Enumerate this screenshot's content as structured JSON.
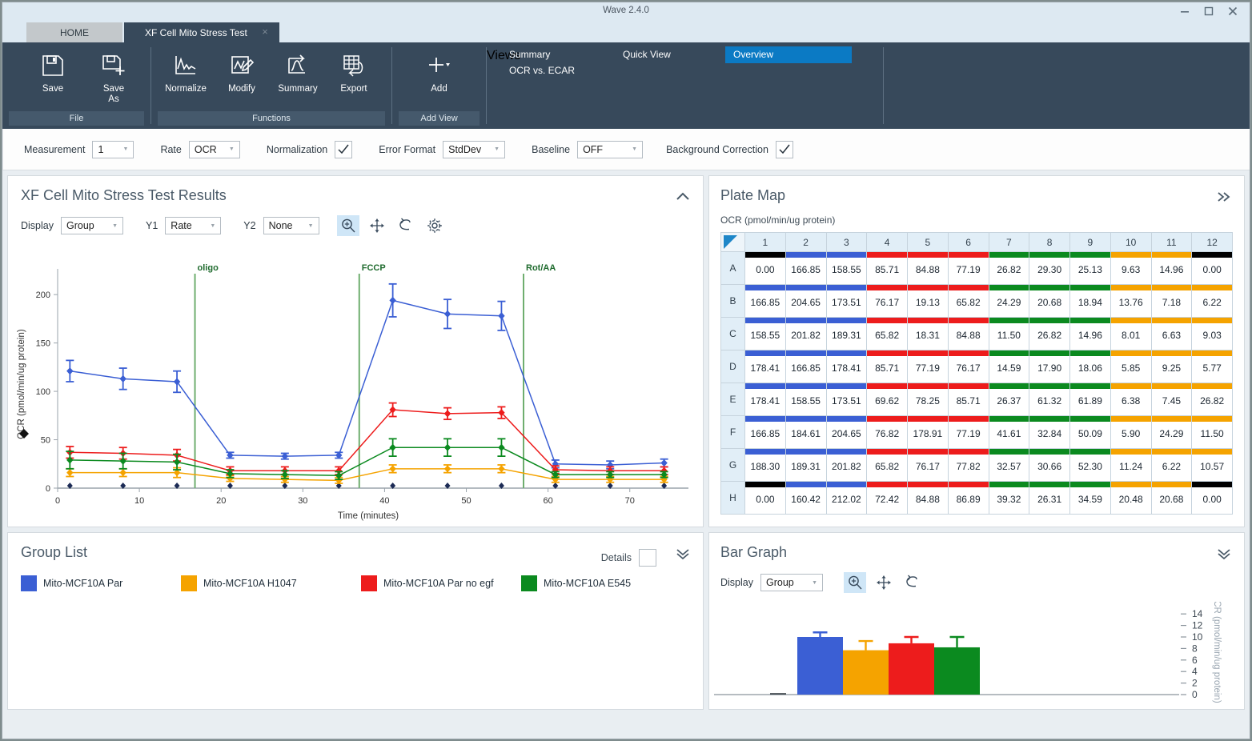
{
  "window": {
    "title": "Wave 2.4.0",
    "minimize": "minimize-icon",
    "maximize": "maximize-icon",
    "close": "close-icon"
  },
  "tabs": [
    {
      "label": "HOME",
      "active": false
    },
    {
      "label": "XF Cell Mito Stress Test",
      "active": true,
      "close": "×"
    }
  ],
  "ribbon": {
    "groups": [
      {
        "label": "File",
        "buttons": [
          {
            "label": "Save"
          },
          {
            "label": "Save\nAs"
          }
        ]
      },
      {
        "label": "Functions",
        "buttons": [
          {
            "label": "Normalize"
          },
          {
            "label": "Modify"
          },
          {
            "label": "Summary"
          },
          {
            "label": "Export"
          }
        ]
      },
      {
        "label": "Add View",
        "buttons": [
          {
            "label": "Add"
          }
        ]
      },
      {
        "label": "Views"
      }
    ],
    "file": {
      "save": "Save",
      "save_as_line1": "Save",
      "save_as_line2": "As",
      "group_label": "File"
    },
    "functions": {
      "normalize": "Normalize",
      "modify": "Modify",
      "summary": "Summary",
      "export": "Export",
      "group_label": "Functions"
    },
    "addview": {
      "add": "Add",
      "group_label": "Add View"
    },
    "views": {
      "group_label": "Views",
      "summary": "Summary",
      "ocr_vs_ecar": "OCR vs. ECAR",
      "quick_view": "Quick View",
      "overview": "Overview",
      "accent": "#0b7ac4"
    }
  },
  "settings": {
    "measurement_label": "Measurement",
    "measurement_value": "1",
    "rate_label": "Rate",
    "rate_value": "OCR",
    "normalization_label": "Normalization",
    "normalization_checked": true,
    "error_format_label": "Error Format",
    "error_format_value": "StdDev",
    "baseline_label": "Baseline",
    "baseline_value": "OFF",
    "background_correction_label": "Background Correction",
    "background_correction_checked": true
  },
  "chart_panel": {
    "title": "XF Cell Mito Stress Test Results",
    "collapse_icon": "chevron-up-icon",
    "display_label": "Display",
    "display_value": "Group",
    "y1_label": "Y1",
    "y1_value": "Rate",
    "y2_label": "Y2",
    "y2_value": "None",
    "tools": [
      "zoom-in-icon",
      "pan-icon",
      "undo-icon",
      "settings-gear-icon"
    ]
  },
  "chart_data": {
    "type": "line",
    "title": "XF Cell Mito Stress Test Results",
    "xlabel": "Time (minutes)",
    "ylabel": "OCR (pmol/min/ug protein)",
    "xlim": [
      0,
      76
    ],
    "ylim": [
      0,
      215
    ],
    "xticks": [
      0,
      10,
      20,
      30,
      40,
      50,
      60,
      70
    ],
    "yticks": [
      0,
      50,
      100,
      150,
      200
    ],
    "grid": false,
    "legend_position": "external-group-list",
    "x": [
      1.5,
      8.0,
      14.6,
      21.1,
      27.8,
      34.4,
      41.0,
      47.7,
      54.3,
      60.9,
      67.6,
      74.2
    ],
    "annotations": [
      {
        "label": "oligo",
        "x": 16.8
      },
      {
        "label": "FCCP",
        "x": 36.9
      },
      {
        "label": "Rot/AA",
        "x": 57.0
      }
    ],
    "series": [
      {
        "name": "Mito-MCF10A Par",
        "color": "#3b5fd4",
        "values": [
          121,
          113,
          110,
          34,
          33,
          34,
          194,
          180,
          178,
          25,
          24,
          26
        ],
        "errors": [
          11,
          11,
          11,
          3,
          3,
          3,
          17,
          15,
          15,
          4,
          4,
          4
        ]
      },
      {
        "name": "Mito-MCF10A H1047",
        "color": "#f5a300",
        "values": [
          16,
          16,
          16,
          10,
          9,
          8,
          20,
          20,
          20,
          9,
          9,
          9
        ],
        "errors": [
          4,
          4,
          5,
          3,
          3,
          3,
          4,
          4,
          4,
          3,
          3,
          3
        ]
      },
      {
        "name": "Mito-MCF10A Par no egf",
        "color": "#ed1c1c",
        "values": [
          37,
          36,
          34,
          18,
          18,
          18,
          81,
          77,
          78,
          19,
          18,
          18
        ],
        "errors": [
          6,
          6,
          6,
          4,
          4,
          4,
          7,
          6,
          6,
          4,
          4,
          4
        ]
      },
      {
        "name": "Mito-MCF10A E545",
        "color": "#0b8a1f",
        "values": [
          29,
          28,
          27,
          15,
          14,
          13,
          42,
          42,
          42,
          14,
          14,
          14
        ],
        "errors": [
          9,
          8,
          8,
          4,
          4,
          4,
          9,
          9,
          9,
          3,
          3,
          3
        ]
      }
    ]
  },
  "plate_map": {
    "title": "Plate Map",
    "expand_icon": "chevron-right-double-icon",
    "unit_caption": "OCR (pmol/min/ug protein)",
    "columns": [
      "1",
      "2",
      "3",
      "4",
      "5",
      "6",
      "7",
      "8",
      "9",
      "10",
      "11",
      "12"
    ],
    "rows": [
      "A",
      "B",
      "C",
      "D",
      "E",
      "F",
      "G",
      "H"
    ],
    "colors": {
      "blank": "#000000",
      "blue": "#3b5fd4",
      "red": "#ed1c1c",
      "green": "#0b8a1f",
      "orange": "#f5a300"
    },
    "group_bands": [
      [
        "blank",
        "blue",
        "blue",
        "red",
        "red",
        "red",
        "green",
        "green",
        "green",
        "orange",
        "orange",
        "blank"
      ],
      [
        "blue",
        "blue",
        "blue",
        "red",
        "red",
        "red",
        "green",
        "green",
        "green",
        "orange",
        "orange",
        "orange"
      ],
      [
        "blue",
        "blue",
        "blue",
        "red",
        "red",
        "red",
        "green",
        "green",
        "green",
        "orange",
        "orange",
        "orange"
      ],
      [
        "blue",
        "blue",
        "blue",
        "red",
        "red",
        "red",
        "green",
        "green",
        "green",
        "orange",
        "orange",
        "orange"
      ],
      [
        "blue",
        "blue",
        "blue",
        "red",
        "red",
        "red",
        "green",
        "green",
        "green",
        "orange",
        "orange",
        "orange"
      ],
      [
        "blue",
        "blue",
        "blue",
        "red",
        "red",
        "red",
        "green",
        "green",
        "green",
        "orange",
        "orange",
        "orange"
      ],
      [
        "blue",
        "blue",
        "blue",
        "red",
        "red",
        "red",
        "green",
        "green",
        "green",
        "orange",
        "orange",
        "orange"
      ],
      [
        "blank",
        "blue",
        "blue",
        "red",
        "red",
        "red",
        "green",
        "green",
        "green",
        "orange",
        "orange",
        "blank"
      ]
    ],
    "values": [
      [
        "0.00",
        "166.85",
        "158.55",
        "85.71",
        "84.88",
        "77.19",
        "26.82",
        "29.30",
        "25.13",
        "9.63",
        "14.96",
        "0.00"
      ],
      [
        "166.85",
        "204.65",
        "173.51",
        "76.17",
        "19.13",
        "65.82",
        "24.29",
        "20.68",
        "18.94",
        "13.76",
        "7.18",
        "6.22"
      ],
      [
        "158.55",
        "201.82",
        "189.31",
        "65.82",
        "18.31",
        "84.88",
        "11.50",
        "26.82",
        "14.96",
        "8.01",
        "6.63",
        "9.03"
      ],
      [
        "178.41",
        "166.85",
        "178.41",
        "85.71",
        "77.19",
        "76.17",
        "14.59",
        "17.90",
        "18.06",
        "5.85",
        "9.25",
        "5.77"
      ],
      [
        "178.41",
        "158.55",
        "173.51",
        "69.62",
        "78.25",
        "85.71",
        "26.37",
        "61.32",
        "61.89",
        "6.38",
        "7.45",
        "26.82"
      ],
      [
        "166.85",
        "184.61",
        "204.65",
        "76.82",
        "178.91",
        "77.19",
        "41.61",
        "32.84",
        "50.09",
        "5.90",
        "24.29",
        "11.50"
      ],
      [
        "188.30",
        "189.31",
        "201.82",
        "65.82",
        "76.17",
        "77.82",
        "32.57",
        "30.66",
        "52.30",
        "11.24",
        "6.22",
        "10.57"
      ],
      [
        "0.00",
        "160.42",
        "212.02",
        "72.42",
        "84.88",
        "86.89",
        "39.32",
        "26.31",
        "34.59",
        "20.48",
        "20.68",
        "0.00"
      ]
    ]
  },
  "group_list": {
    "title": "Group List",
    "details_label": "Details",
    "details_checked": false,
    "collapse_icon": "chevron-down-double-icon",
    "groups": [
      {
        "label": "Mito-MCF10A Par",
        "color": "#3b5fd4"
      },
      {
        "label": "Mito-MCF10A H1047",
        "color": "#f5a300"
      },
      {
        "label": "Mito-MCF10A Par no egf",
        "color": "#ed1c1c"
      },
      {
        "label": "Mito-MCF10A E545",
        "color": "#0b8a1f"
      }
    ]
  },
  "bar_graph": {
    "title": "Bar Graph",
    "collapse_icon": "chevron-down-double-icon",
    "display_label": "Display",
    "display_value": "Group",
    "tools": [
      "zoom-in-icon",
      "pan-icon",
      "undo-icon"
    ],
    "chart_data": {
      "type": "bar",
      "ylabel": "OCR (pmol/min/ug protein)",
      "yticks": [
        0,
        2,
        4,
        6,
        8,
        10,
        12,
        14
      ],
      "ylim": [
        0,
        15
      ],
      "categories": [
        "Mito-MCF10A Par",
        "Mito-MCF10A H1047",
        "Mito-MCF10A Par no egf",
        "Mito-MCF10A E545"
      ],
      "values": [
        10.0,
        7.7,
        8.9,
        8.2
      ],
      "errors": [
        0.8,
        1.6,
        1.1,
        1.8
      ],
      "colors": [
        "#3b5fd4",
        "#f5a300",
        "#ed1c1c",
        "#0b8a1f"
      ]
    }
  }
}
